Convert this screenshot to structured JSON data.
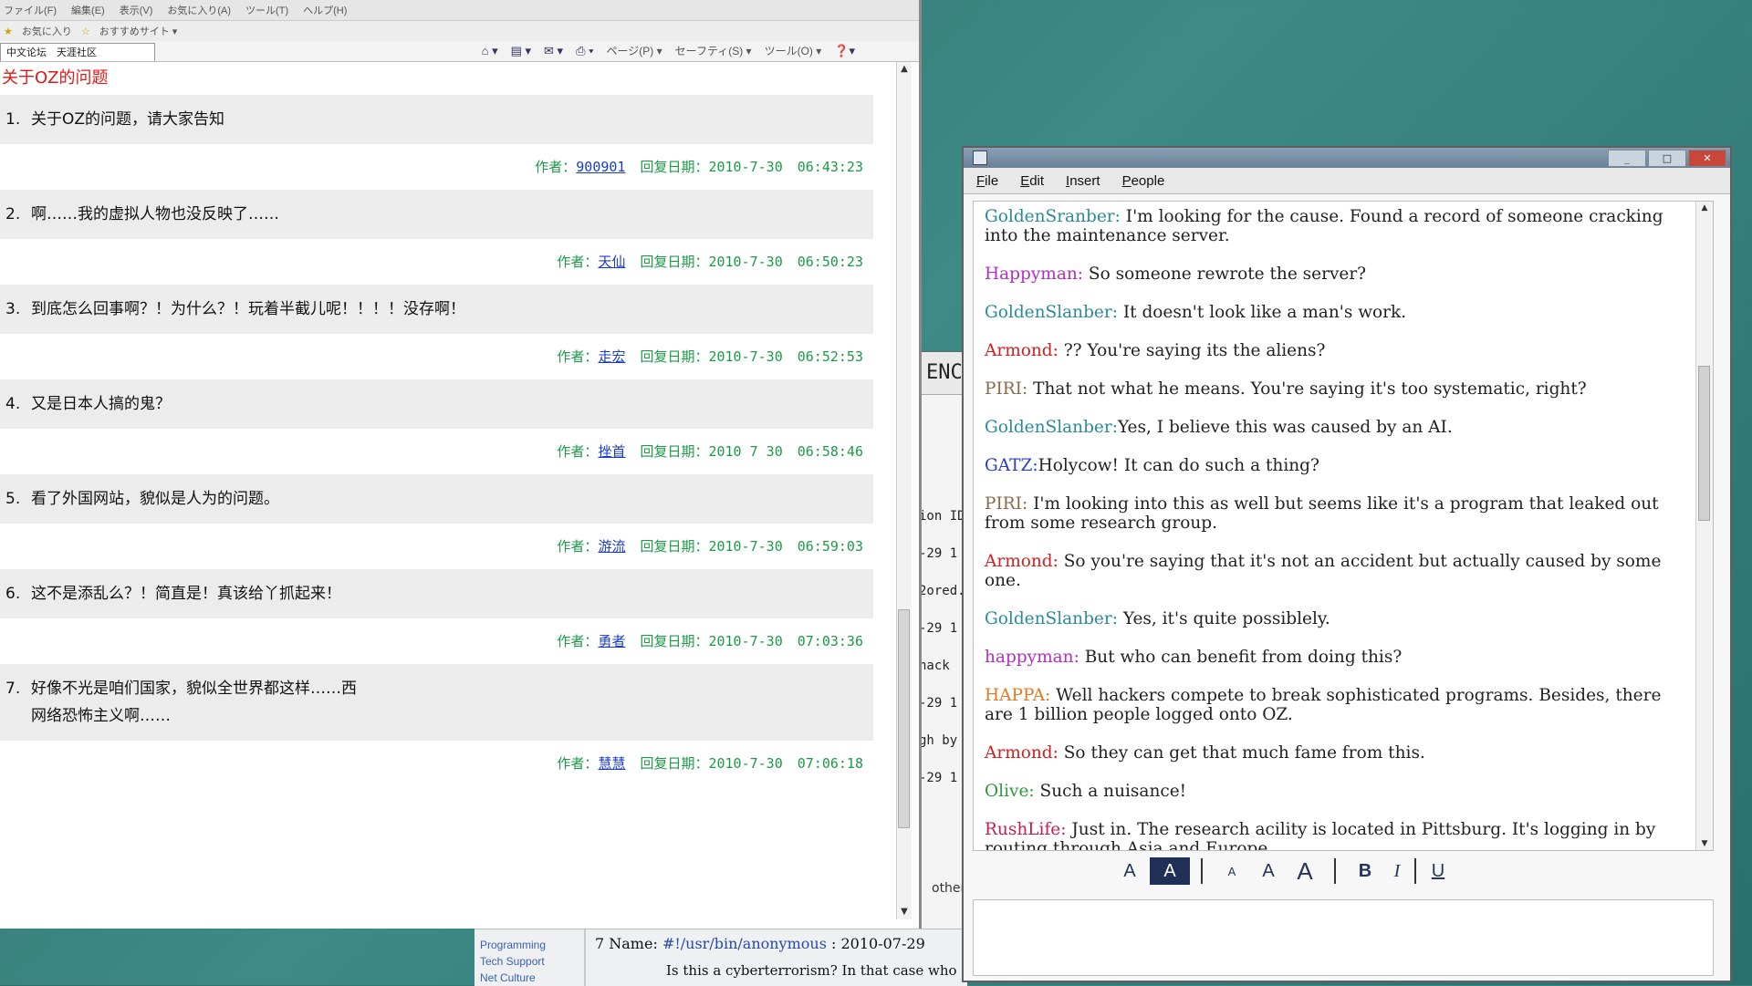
{
  "background_window": {
    "title": "ENCO",
    "side_labels": [
      "ion ID",
      "-29 1",
      "2ored.",
      "-29 1",
      "hack",
      "-29 1",
      "gh by",
      "-29 1"
    ],
    "more_services": "other services as well."
  },
  "background_footer": {
    "links": [
      "Programming",
      "Tech Support",
      "Net Culture"
    ],
    "name_label": "7 Name:",
    "name_value": "#!/usr/bin/anonymous",
    "name_date": ": 2010-07-29",
    "question": "Is this a cyberterrorism? In that case who o"
  },
  "browser": {
    "menu": [
      "ファイル(F)",
      "編集(E)",
      "表示(V)",
      "お気に入り(A)",
      "ツール(T)",
      "ヘルプ(H)"
    ],
    "favorites": [
      "お気に入り",
      "おすすめサイト ▾"
    ],
    "tab": "中文论坛　天涯社区",
    "toolbar": [
      "ページ(P) ▾",
      "セーフティ(S) ▾",
      "ツール(O) ▾"
    ],
    "forum_title": "关于OZ的问题",
    "author_label": "作者：",
    "date_label": "回复日期：",
    "posts": [
      {
        "num": "1.",
        "subject": "关于OZ的问题，请大家告知",
        "subject2": "",
        "author": "900901",
        "date": "2010-7-30",
        "time": "06:43:23"
      },
      {
        "num": "2.",
        "subject": "啊……我的虚拟人物也没反映了……",
        "subject2": "",
        "author": "天仙",
        "date": "2010-7-30",
        "time": "06:50:23"
      },
      {
        "num": "3.",
        "subject": "到底怎么回事啊？！为什么？！玩着半截儿呢！！！！没存啊！",
        "subject2": "",
        "author": "走宏",
        "date": "2010-7-30",
        "time": "06:52:53"
      },
      {
        "num": "4.",
        "subject": "又是日本人搞的鬼？",
        "subject2": "",
        "author": "挫首",
        "date": "2010 7 30",
        "time": "06:58:46"
      },
      {
        "num": "5.",
        "subject": "看了外国网站，貌似是人为的问题。",
        "subject2": "",
        "author": "游流",
        "date": "2010-7-30",
        "time": "06:59:03"
      },
      {
        "num": "6.",
        "subject": "这不是添乱么？！简直是！真该给丫抓起来！",
        "subject2": "",
        "author": "勇者",
        "date": "2010-7-30",
        "time": "07:03:36"
      },
      {
        "num": "7.",
        "subject": "好像不光是咱们国家，貌似全世界都这样……西",
        "subject2": "网络恐怖主义啊……",
        "author": "慧慧",
        "date": "2010-7-30",
        "time": "07:06:18"
      }
    ]
  },
  "chat": {
    "menu": [
      "File",
      "Edit",
      "Insert",
      "People"
    ],
    "messages": [
      {
        "nick": "GoldenSranber:",
        "color": "#2a8a9a",
        "text": " I'm looking for the cause. Found a record of someone cracking into the maintenance server."
      },
      {
        "nick": "Happyman:",
        "color": "#b02fc0",
        "text": " So someone rewrote the server?"
      },
      {
        "nick": "GoldenSlanber:",
        "color": "#2a8a9a",
        "text": " It doesn't look like a man's work."
      },
      {
        "nick": "Armond:",
        "color": "#d02020",
        "text": " ?? You're saying its the aliens?"
      },
      {
        "nick": "PIRI:",
        "color": "#8a6a4a",
        "text": " That not what he means. You're saying it's too systematic, right?"
      },
      {
        "nick": "GoldenSlanber:",
        "color": "#2a8a9a",
        "text": "Yes, I believe this was caused by an AI."
      },
      {
        "nick": "GATZ:",
        "color": "#2a3fbf",
        "text": "Holycow! It can do such a thing?"
      },
      {
        "nick": "PIRI:",
        "color": "#8a6a4a",
        "text": " I'm looking  into this as well but seems like it's a program that leaked out from some research group."
      },
      {
        "nick": "Armond:",
        "color": "#d02020",
        "text": " So you're saying that it's not an accident but actually caused by some one."
      },
      {
        "nick": "GoldenSlanber:",
        "color": "#2a8a9a",
        "text": " Yes, it's quite possiblely."
      },
      {
        "nick": "happyman:",
        "color": "#b02fc0",
        "text": " But who can benefit from doing this?"
      },
      {
        "nick": "HAPPA:",
        "color": "#e07a20",
        "text": " Well hackers compete to break sophisticated programs. Besides, there are 1 billion people logged onto OZ."
      },
      {
        "nick": "Armond:",
        "color": "#d02020",
        "text": " So they can get that much fame from this."
      },
      {
        "nick": "Olive:",
        "color": "#2c9a3a",
        "text": " Such a nuisance!"
      },
      {
        "nick": "RushLife:",
        "color": "#c02050",
        "text": " Just in. The research acility is located in Pittsburg. It's logging in by routing through Asia and Europe."
      }
    ],
    "format_buttons": [
      "A",
      "A",
      "A",
      "A",
      "A",
      "B",
      "I",
      "U"
    ],
    "window_buttons": [
      "_",
      "□",
      "✕"
    ]
  }
}
